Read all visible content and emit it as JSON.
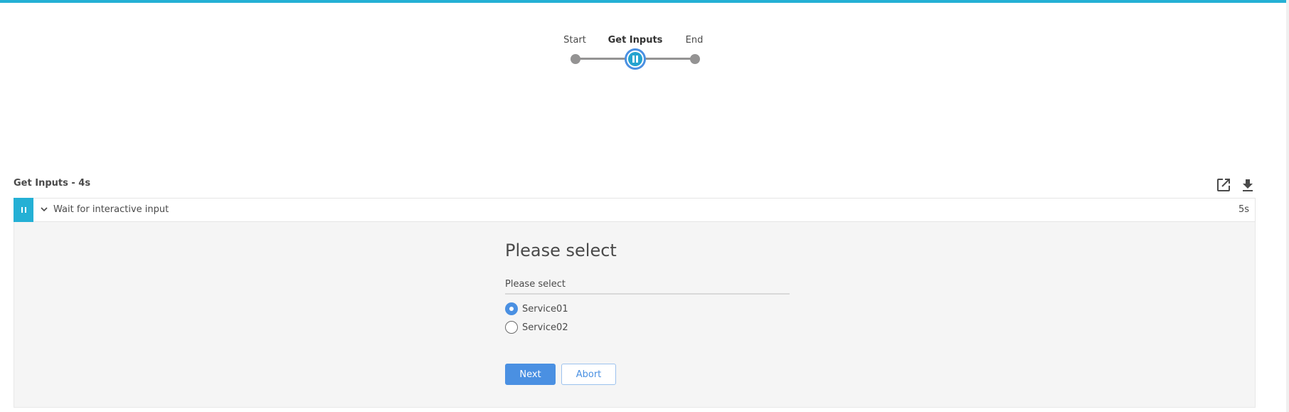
{
  "colors": {
    "brand": "#24b0d5",
    "accent": "#4a90e2",
    "node_inactive": "#949393"
  },
  "pipeline": {
    "stages": [
      {
        "label": "Start",
        "state": "completed"
      },
      {
        "label": "Get Inputs",
        "state": "paused",
        "icon": "pause-icon"
      },
      {
        "label": "End",
        "state": "not-built"
      }
    ]
  },
  "stage_detail": {
    "title": "Get Inputs - 4s",
    "actions": [
      {
        "name": "open-in-new-window",
        "icon": "external-link-icon"
      },
      {
        "name": "download-log",
        "icon": "download-icon"
      }
    ],
    "step": {
      "status_icon": "pause-icon",
      "expand_icon": "chevron-down-icon",
      "label": "Wait for interactive input",
      "duration": "5s"
    }
  },
  "input_form": {
    "heading": "Please select",
    "field_label": "Please select",
    "options": [
      {
        "label": "Service01",
        "selected": true
      },
      {
        "label": "Service02",
        "selected": false
      }
    ],
    "submit_label": "Next",
    "abort_label": "Abort"
  }
}
